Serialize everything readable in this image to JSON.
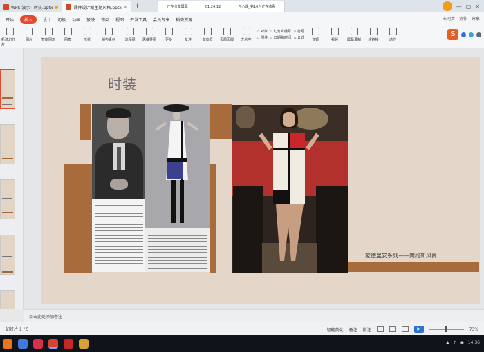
{
  "titlebar": {
    "tabs": [
      {
        "label": "WPS 演示 · 时装.pptx",
        "active": false
      },
      {
        "label": "课件设计新主题风格.pptx",
        "active": true
      }
    ],
    "add_tab": "+",
    "notification": {
      "title": "正在分享屏幕",
      "time": "01:24:12",
      "info": "开心课_第10人正在收看"
    },
    "window": {
      "minimize": "—",
      "maximize": "▢",
      "close": "✕"
    }
  },
  "menu": {
    "tabs": [
      "开始",
      "插入",
      "设计",
      "切换",
      "动画",
      "放映",
      "审阅",
      "视图",
      "开发工具",
      "会员专享",
      "稻壳资源"
    ],
    "active": "插入",
    "right": {
      "share": "未同步",
      "collab": "协作",
      "more": "分享"
    }
  },
  "ribbon": {
    "buttons": [
      "新建幻灯片",
      "图片",
      "智能图形",
      "图表",
      "形状",
      "稻壳素材",
      "流程图",
      "思维导图",
      "更多",
      "批注",
      "文本框",
      "页眉页脚",
      "艺术字",
      "音频",
      "视频",
      "屏幕录制",
      "超链接",
      "动作",
      "WPS 演示"
    ],
    "stack1": [
      "对象",
      "附件"
    ],
    "stack2": [
      "幻灯片编号",
      "日期和时间"
    ],
    "stack3": [
      "符号",
      "公式"
    ]
  },
  "slide": {
    "title": "时装",
    "caption": "蒙德里安系列——简约新风尚"
  },
  "notes": {
    "placeholder": "单击此处添加备注"
  },
  "status": {
    "left": "幻灯片 1 / 5",
    "beautify": "智能美化",
    "notes_btn": "备注",
    "comment_btn": "批注",
    "zoom": "73%"
  },
  "taskbar": {
    "icons": [
      "firefox-icon",
      "editor-icon",
      "opera-icon",
      "wps-icon",
      "sim-icon",
      "image-viewer-icon"
    ],
    "colors": [
      "#e8751a",
      "#3d7be0",
      "#d6304b",
      "#d8432b",
      "#c8262a",
      "#d9a334"
    ],
    "time": "14:36"
  },
  "colors": {
    "accent": "#e24b31",
    "slide_bg": "#e4d7c9",
    "slide_brown": "#a86b3b"
  }
}
